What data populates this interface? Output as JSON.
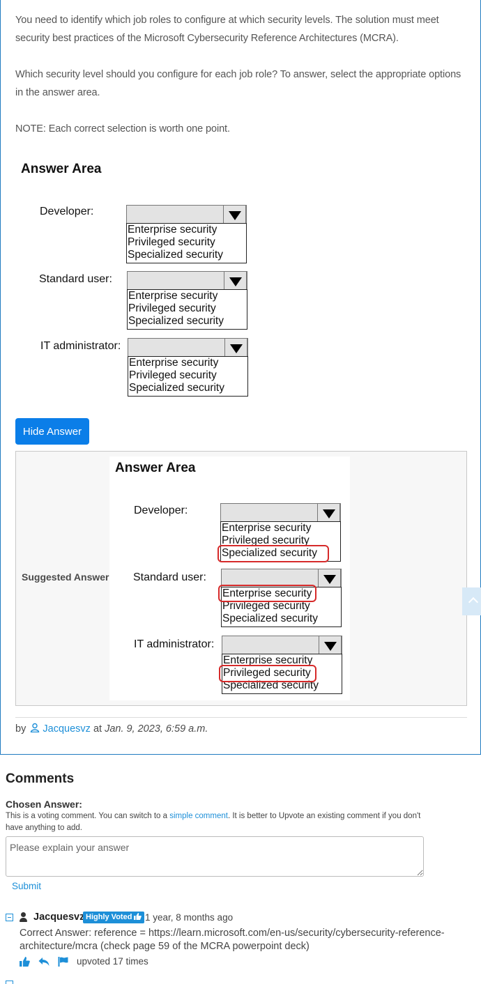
{
  "question": {
    "paragraph_1": "You need to identify which job roles to configure at which security levels. The solution must meet security best practices of the Microsoft Cybersecurity Reference Architectures (MCRA).",
    "paragraph_2": "Which security level should you configure for each job role? To answer, select the appropriate options in the answer area.",
    "note": "NOTE: Each correct selection is worth one point."
  },
  "answer_area": {
    "title": "Answer Area",
    "roles": [
      {
        "label": "Developer:"
      },
      {
        "label": "Standard user:"
      },
      {
        "label": "IT administrator:"
      }
    ],
    "options": [
      "Enterprise security",
      "Privileged security",
      "Specialized security"
    ]
  },
  "hide_answer_label": "Hide Answer",
  "suggested": {
    "label": "Suggested Answer:",
    "selected": [
      {
        "role": "Developer:",
        "answer": "Specialized security"
      },
      {
        "role": "Standard user:",
        "answer": "Enterprise security"
      },
      {
        "role": "IT administrator:",
        "answer": "Privileged security"
      }
    ]
  },
  "byline": {
    "by": "by",
    "user": "Jacquesvz",
    "at": "at",
    "date": "Jan. 9, 2023, 6:59 a.m."
  },
  "comments": {
    "title": "Comments",
    "chosen_label": "Chosen Answer:",
    "note_before": "This is a voting comment. You can switch to a ",
    "note_link": "simple comment",
    "note_after": ". It is better to Upvote an existing comment if you don't have anything to add.",
    "placeholder": "Please explain your answer",
    "submit": "Submit",
    "items": [
      {
        "user": "Jacquesvz",
        "badge": "Highly Voted",
        "time": "1 year, 8 months ago",
        "body": "Correct Answer: reference = https://learn.microsoft.com/en-us/security/cybersecurity-reference-architecture/mcra (check page 59 of the MCRA powerpoint deck)",
        "upvotes": "upvoted 17 times"
      }
    ]
  },
  "colors": {
    "accent": "#1d8fd8",
    "button": "#0b7ee8",
    "highlight": "#d62a2a"
  }
}
